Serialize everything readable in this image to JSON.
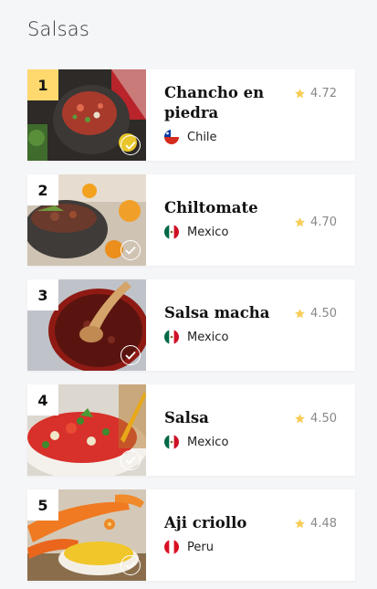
{
  "page": {
    "title": "Salsas"
  },
  "colors": {
    "rank_gold": "#ffd86e",
    "star": "#f8cd58"
  },
  "items": [
    {
      "rank": "1",
      "name": "Chancho en piedra",
      "country": "Chile",
      "flag_icon": "chile-flag-icon",
      "rating": "4.72",
      "checked": true
    },
    {
      "rank": "2",
      "name": "Chiltomate",
      "country": "Mexico",
      "flag_icon": "mexico-flag-icon",
      "rating": "4.70",
      "checked": true
    },
    {
      "rank": "3",
      "name": "Salsa macha",
      "country": "Mexico",
      "flag_icon": "mexico-flag-icon",
      "rating": "4.50",
      "checked": true
    },
    {
      "rank": "4",
      "name": "Salsa",
      "country": "Mexico",
      "flag_icon": "mexico-flag-icon",
      "rating": "4.50",
      "checked": true
    },
    {
      "rank": "5",
      "name": "Aji criollo",
      "country": "Peru",
      "flag_icon": "peru-flag-icon",
      "rating": "4.48",
      "checked": true
    }
  ]
}
